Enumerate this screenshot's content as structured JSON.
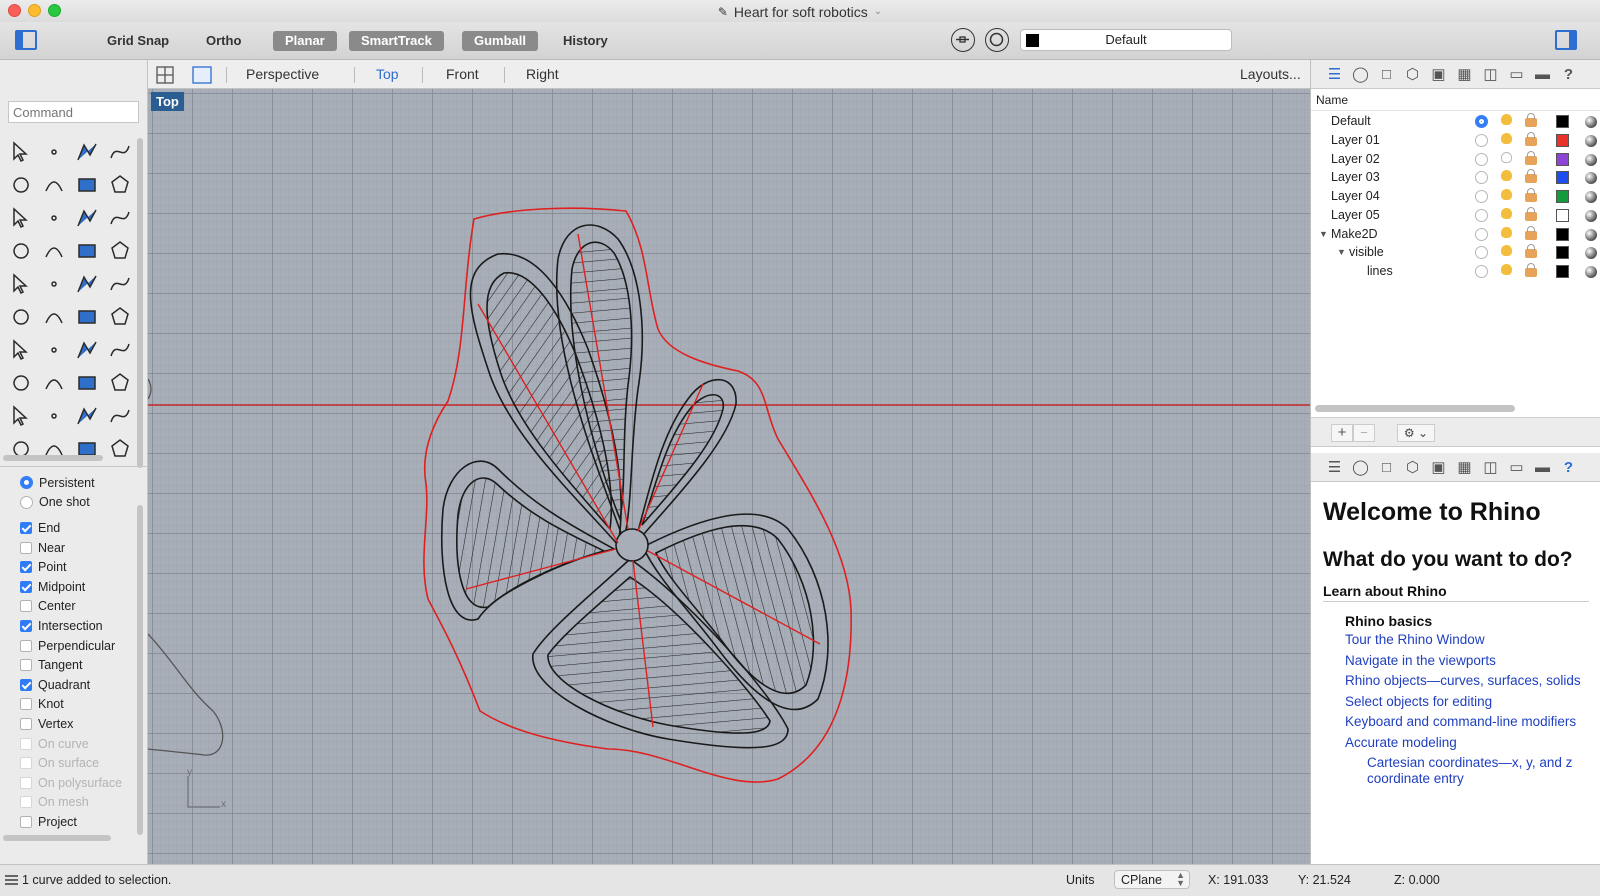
{
  "window": {
    "title": "Heart for soft robotics"
  },
  "toolbar": {
    "grid_snap": "Grid Snap",
    "ortho": "Ortho",
    "planar": "Planar",
    "smarttrack": "SmartTrack",
    "gumball": "Gumball",
    "history": "History",
    "current_layer": "Default"
  },
  "command": {
    "placeholder": "Command"
  },
  "viewports": {
    "tabs": [
      "Perspective",
      "Top",
      "Front",
      "Right"
    ],
    "active": "Top",
    "layouts": "Layouts...",
    "label": "Top",
    "axis_x": "x",
    "axis_y": "y"
  },
  "osnap": {
    "mode": [
      {
        "label": "Persistent",
        "selected": true
      },
      {
        "label": "One shot",
        "selected": false
      }
    ],
    "items": [
      {
        "label": "End",
        "checked": true,
        "enabled": true
      },
      {
        "label": "Near",
        "checked": false,
        "enabled": true
      },
      {
        "label": "Point",
        "checked": true,
        "enabled": true
      },
      {
        "label": "Midpoint",
        "checked": true,
        "enabled": true
      },
      {
        "label": "Center",
        "checked": false,
        "enabled": true
      },
      {
        "label": "Intersection",
        "checked": true,
        "enabled": true
      },
      {
        "label": "Perpendicular",
        "checked": false,
        "enabled": true
      },
      {
        "label": "Tangent",
        "checked": false,
        "enabled": true
      },
      {
        "label": "Quadrant",
        "checked": true,
        "enabled": true
      },
      {
        "label": "Knot",
        "checked": false,
        "enabled": true
      },
      {
        "label": "Vertex",
        "checked": false,
        "enabled": true
      },
      {
        "label": "On curve",
        "checked": false,
        "enabled": false
      },
      {
        "label": "On surface",
        "checked": false,
        "enabled": false
      },
      {
        "label": "On polysurface",
        "checked": false,
        "enabled": false
      },
      {
        "label": "On mesh",
        "checked": false,
        "enabled": false
      },
      {
        "label": "Project",
        "checked": false,
        "enabled": true
      }
    ]
  },
  "layers": {
    "header": "Name",
    "rows": [
      {
        "name": "Default",
        "current": true,
        "color": "#000000",
        "level": 0,
        "on": true
      },
      {
        "name": "Layer 01",
        "current": false,
        "color": "#e8322a",
        "level": 0,
        "on": true
      },
      {
        "name": "Layer 02",
        "current": false,
        "color": "#8e44d6",
        "level": 0,
        "on": false
      },
      {
        "name": "Layer 03",
        "current": false,
        "color": "#1d4ff0",
        "level": 0,
        "on": true
      },
      {
        "name": "Layer 04",
        "current": false,
        "color": "#139b3c",
        "level": 0,
        "on": true
      },
      {
        "name": "Layer 05",
        "current": false,
        "color": "#ffffff",
        "level": 0,
        "on": true
      },
      {
        "name": "Make2D",
        "current": false,
        "color": "#000000",
        "level": 0,
        "on": true,
        "expanded": true
      },
      {
        "name": "visible",
        "current": false,
        "color": "#000000",
        "level": 1,
        "on": true,
        "expanded": true
      },
      {
        "name": "lines",
        "current": false,
        "color": "#000000",
        "level": 2,
        "on": true
      }
    ]
  },
  "help": {
    "title": "Welcome to Rhino",
    "question": "What do you want to do?",
    "section": "Learn about Rhino",
    "subsection": "Rhino basics",
    "links": [
      "Tour the Rhino Window",
      "Navigate in the viewports",
      "Rhino objects—curves, surfaces, solids",
      "Select objects for editing",
      "Keyboard and command-line modifiers",
      "Accurate modeling"
    ],
    "sublink": "Cartesian coordinates—x, y, and z coordinate entry"
  },
  "status": {
    "message": "1 curve added to selection.",
    "units": "Units",
    "cplane": "CPlane",
    "x": "X: 191.033",
    "y": "Y: 21.524",
    "z": "Z: 0.000"
  },
  "colors": {
    "accent": "#2d6ed0",
    "viewport_bg": "#a7aeb8",
    "curve_red": "#e02020",
    "curve_black": "#1a1a1a"
  },
  "icons": {
    "toolbar": [
      "sidebar-toggle-icon",
      "lock-icon",
      "target-icon",
      "layer-color-swatch",
      "panel-toggle-icon"
    ],
    "panel_tabs": [
      "layers-icon",
      "properties-icon",
      "document-icon",
      "cube-icon",
      "camera-icon",
      "render-icon",
      "printer-icon",
      "window-icon",
      "display-icon",
      "help-icon"
    ]
  }
}
